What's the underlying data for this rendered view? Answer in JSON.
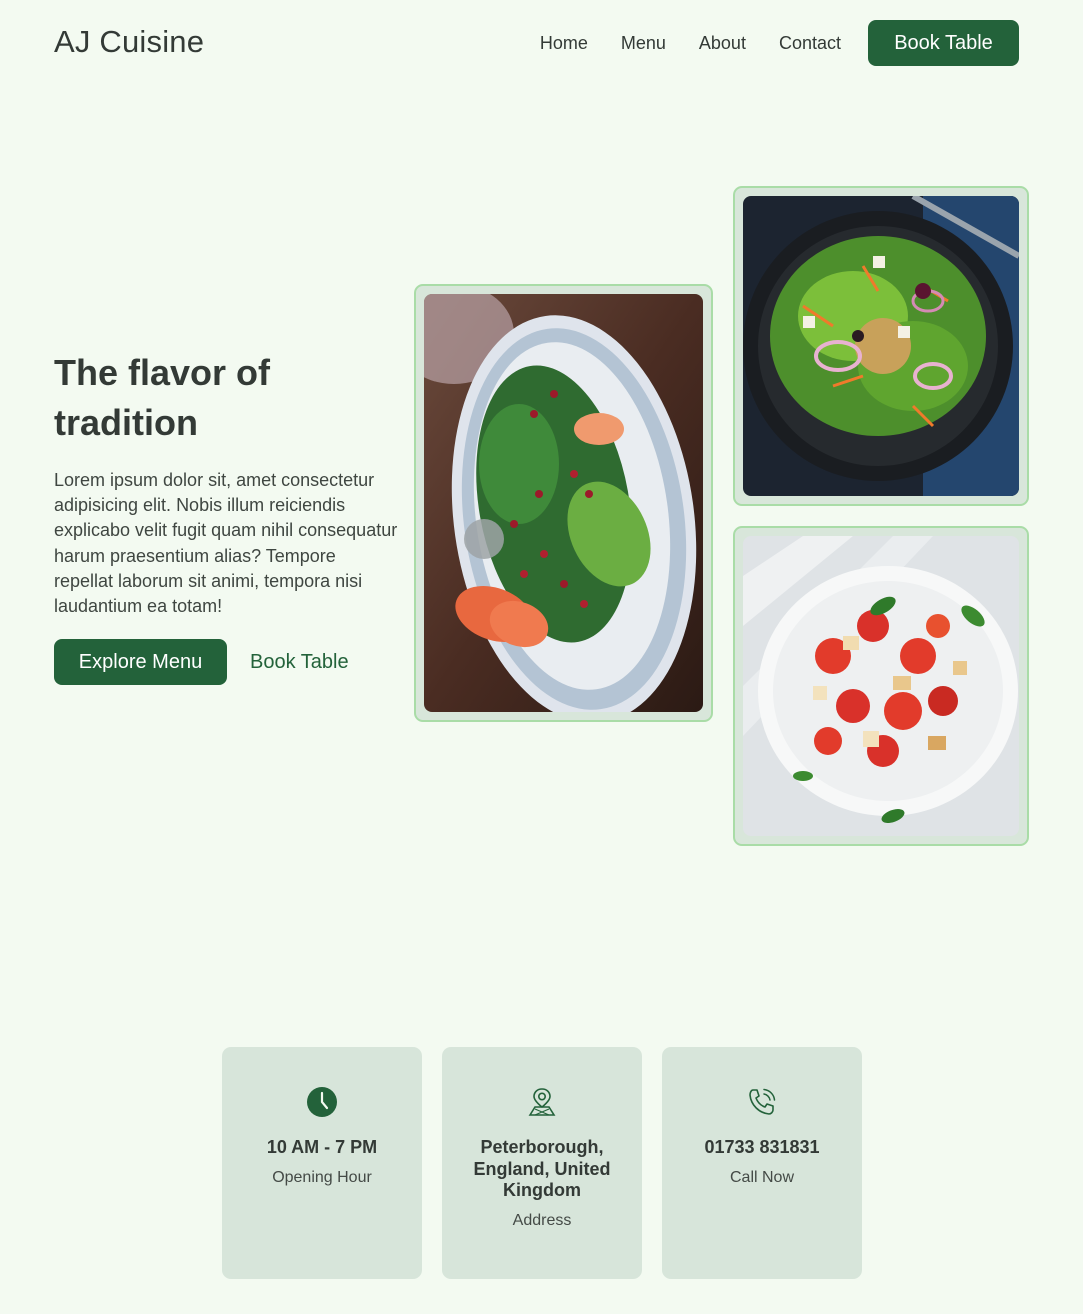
{
  "header": {
    "brand": "AJ Cuisine",
    "nav": [
      "Home",
      "Menu",
      "About",
      "Contact"
    ],
    "cta": "Book Table"
  },
  "hero": {
    "title": "The flavor of tradition",
    "text": "Lorem ipsum dolor sit, amet consectetur adipisicing elit. Nobis illum reiciendis explicabo velit fugit quam nihil consequatur harum praesentium alias? Tempore repellat laborum sit animi, tempora nisi laudantium ea totam!",
    "primary_button": "Explore Menu",
    "secondary_button": "Book Table"
  },
  "photos": [
    {
      "icon": "salad-plate-image"
    },
    {
      "icon": "green-salad-bowl-image"
    },
    {
      "icon": "tomato-salad-image"
    }
  ],
  "info": [
    {
      "icon": "clock-icon",
      "value": "10 AM - 7 PM",
      "label": "Opening Hour"
    },
    {
      "icon": "map-pin-icon",
      "value": "Peterborough, England, United Kingdom",
      "label": "Address"
    },
    {
      "icon": "phone-icon",
      "value": "01733 831831",
      "label": "Call Now"
    }
  ],
  "colors": {
    "background": "#f3faf1",
    "accent": "#23623a",
    "card": "#d7e5da",
    "frame_border": "#a9dca7",
    "text": "#333a36"
  }
}
